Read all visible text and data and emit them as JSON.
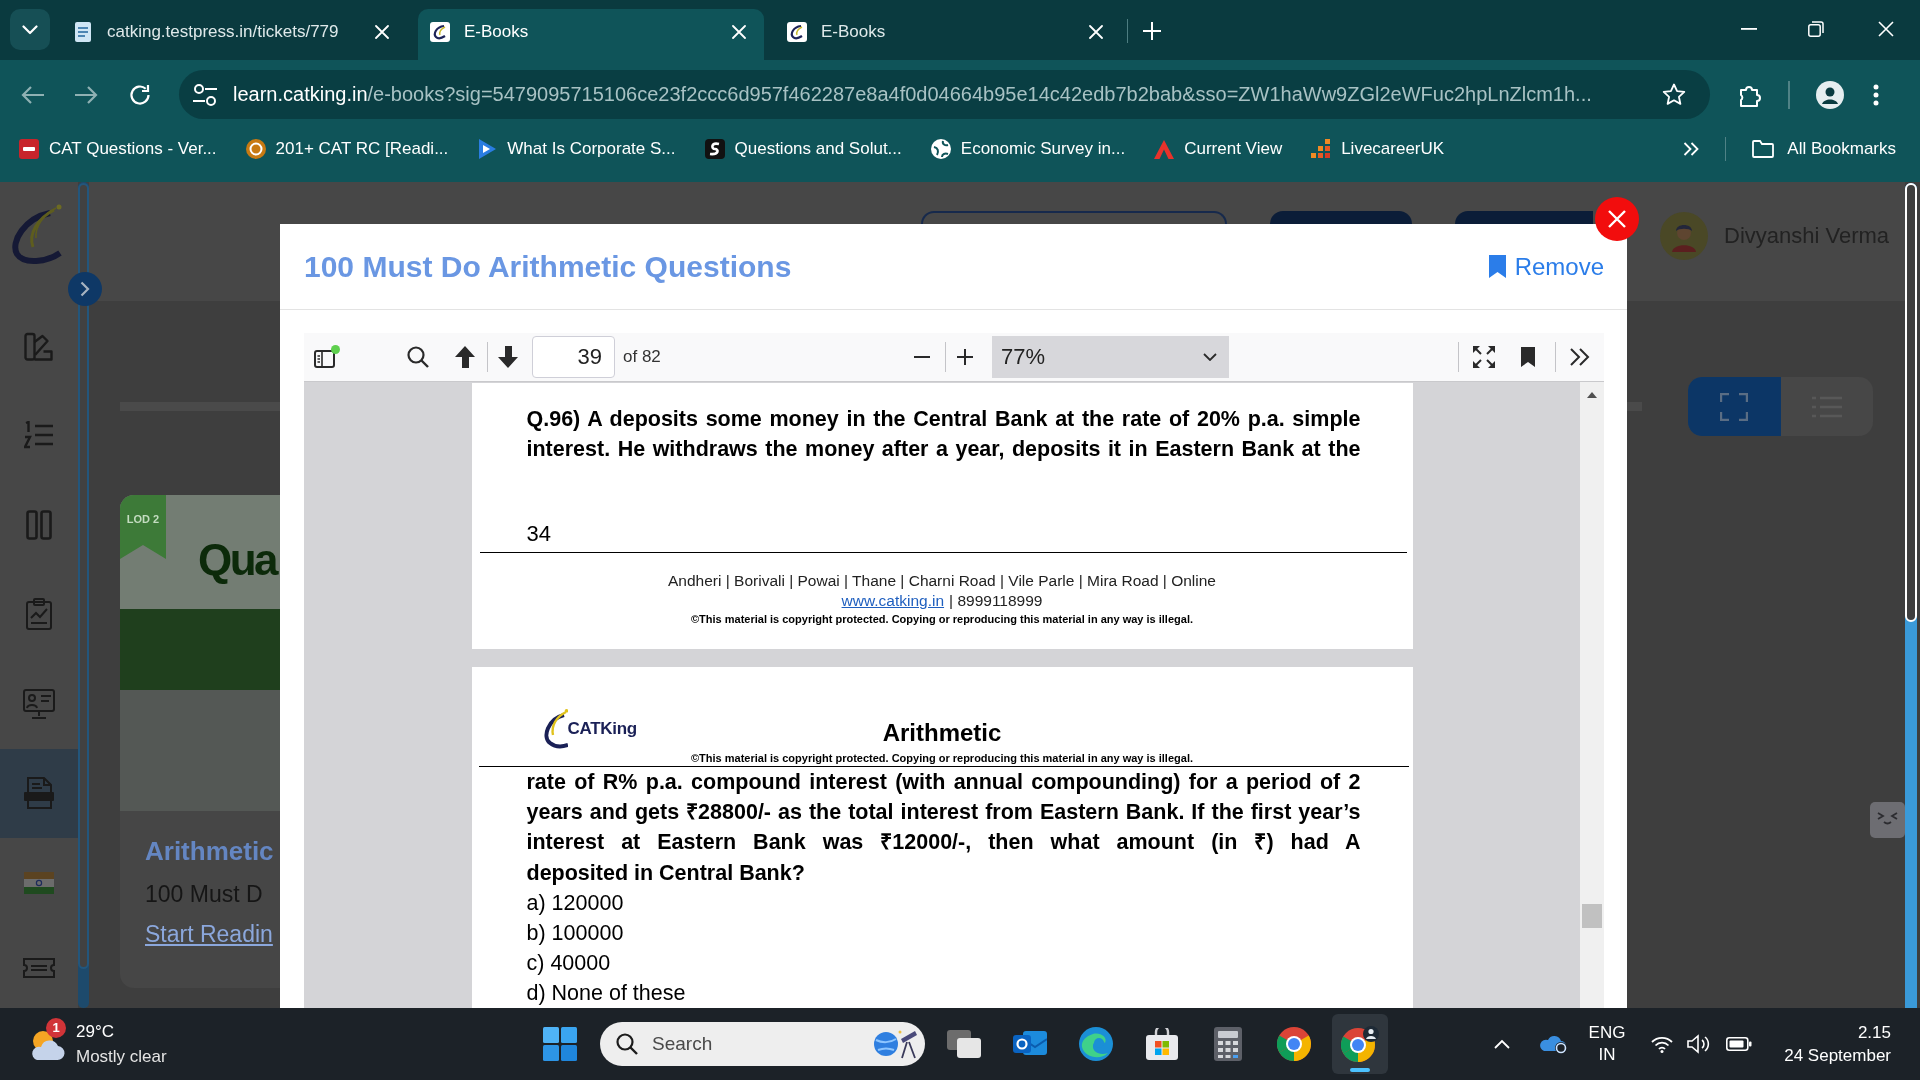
{
  "browser": {
    "tabs": [
      {
        "title": "catking.testpress.in/tickets/779",
        "selected": false
      },
      {
        "title": "E-Books",
        "selected": true
      },
      {
        "title": "E-Books",
        "selected": false
      }
    ],
    "address": {
      "host": "learn.catking.in",
      "path": "/e-books?sig=5479095715106ce23f2ccc6d957f462287e8a4f0d04664b95e14c42edb7b2bab&sso=ZW1haWw9ZGl2eWFuc2hpLnZlcm1h..."
    },
    "bookmarks": [
      "CAT Questions - Ver...",
      "201+ CAT RC [Readi...",
      "What Is Corporate S...",
      "Questions and Solut...",
      "Economic Survey in...",
      "Current View",
      "LivecareerUK"
    ],
    "all_bookmarks": "All Bookmarks"
  },
  "site": {
    "nav": [
      {
        "selected": false
      },
      {
        "selected": false
      },
      {
        "selected": false
      },
      {
        "selected": false
      },
      {
        "selected": false
      },
      {
        "selected": true
      },
      {
        "selected": false
      },
      {
        "selected": false
      }
    ],
    "user": {
      "name": "Divyanshi Verma"
    },
    "view_toggle": [
      {
        "selected": true
      },
      {
        "selected": false
      }
    ],
    "card": {
      "ribbon": "LOD 2",
      "banner": "Qua",
      "title": "Arithmetic",
      "subtitle": "100 Must D",
      "link": "Start Readin"
    }
  },
  "modal": {
    "title": "100 Must Do Arithmetic Questions",
    "action": "Remove",
    "toolbar": {
      "page": "39",
      "page_count": "of 82",
      "zoom": "77%"
    },
    "page_end": {
      "lines": [
        "Q.96) A deposits some money in the Central Bank at the rate of 20% p.a. simple",
        "interest. He withdraws the money after a year, deposits it in Eastern Bank at the"
      ],
      "page_number": "34",
      "branches": "Andheri | Borivali | Powai | Thane | Charni Road | Vile Parle | Mira Road | Online",
      "website": "www.catking.in",
      "phone": "| 8999118999",
      "copyright": "©This material is copyright protected. Copying or reproducing this material in any way is illegal."
    },
    "page_start": {
      "logo": "CATKing",
      "heading": "Arithmetic",
      "copyright": "©This material is copyright protected. Copying or reproducing this material in any way is illegal.",
      "lines": [
        "rate of R% p.a. compound interest (with annual compounding) for a period of 2",
        "years and gets ₹28800/- as the total interest from Eastern Bank. If the first year’s",
        "interest at Eastern Bank was ₹12000/-, then what amount (in ₹) had A",
        "deposited in Central Bank?"
      ],
      "options": [
        "a) 120000",
        "b) 100000",
        "c) 40000",
        "d) None of these"
      ]
    }
  },
  "taskbar": {
    "weather": {
      "badge": "1",
      "temperature": "29°C",
      "condition": "Mostly clear"
    },
    "search": {
      "placeholder": "Search"
    },
    "apps": [
      {
        "selected": false
      },
      {
        "selected": false
      },
      {
        "selected": false
      },
      {
        "selected": false
      },
      {
        "selected": false
      },
      {
        "selected": false
      },
      {
        "selected": true
      }
    ],
    "language": "ENG",
    "region": "IN",
    "time": "2.15",
    "date": "24 September"
  }
}
